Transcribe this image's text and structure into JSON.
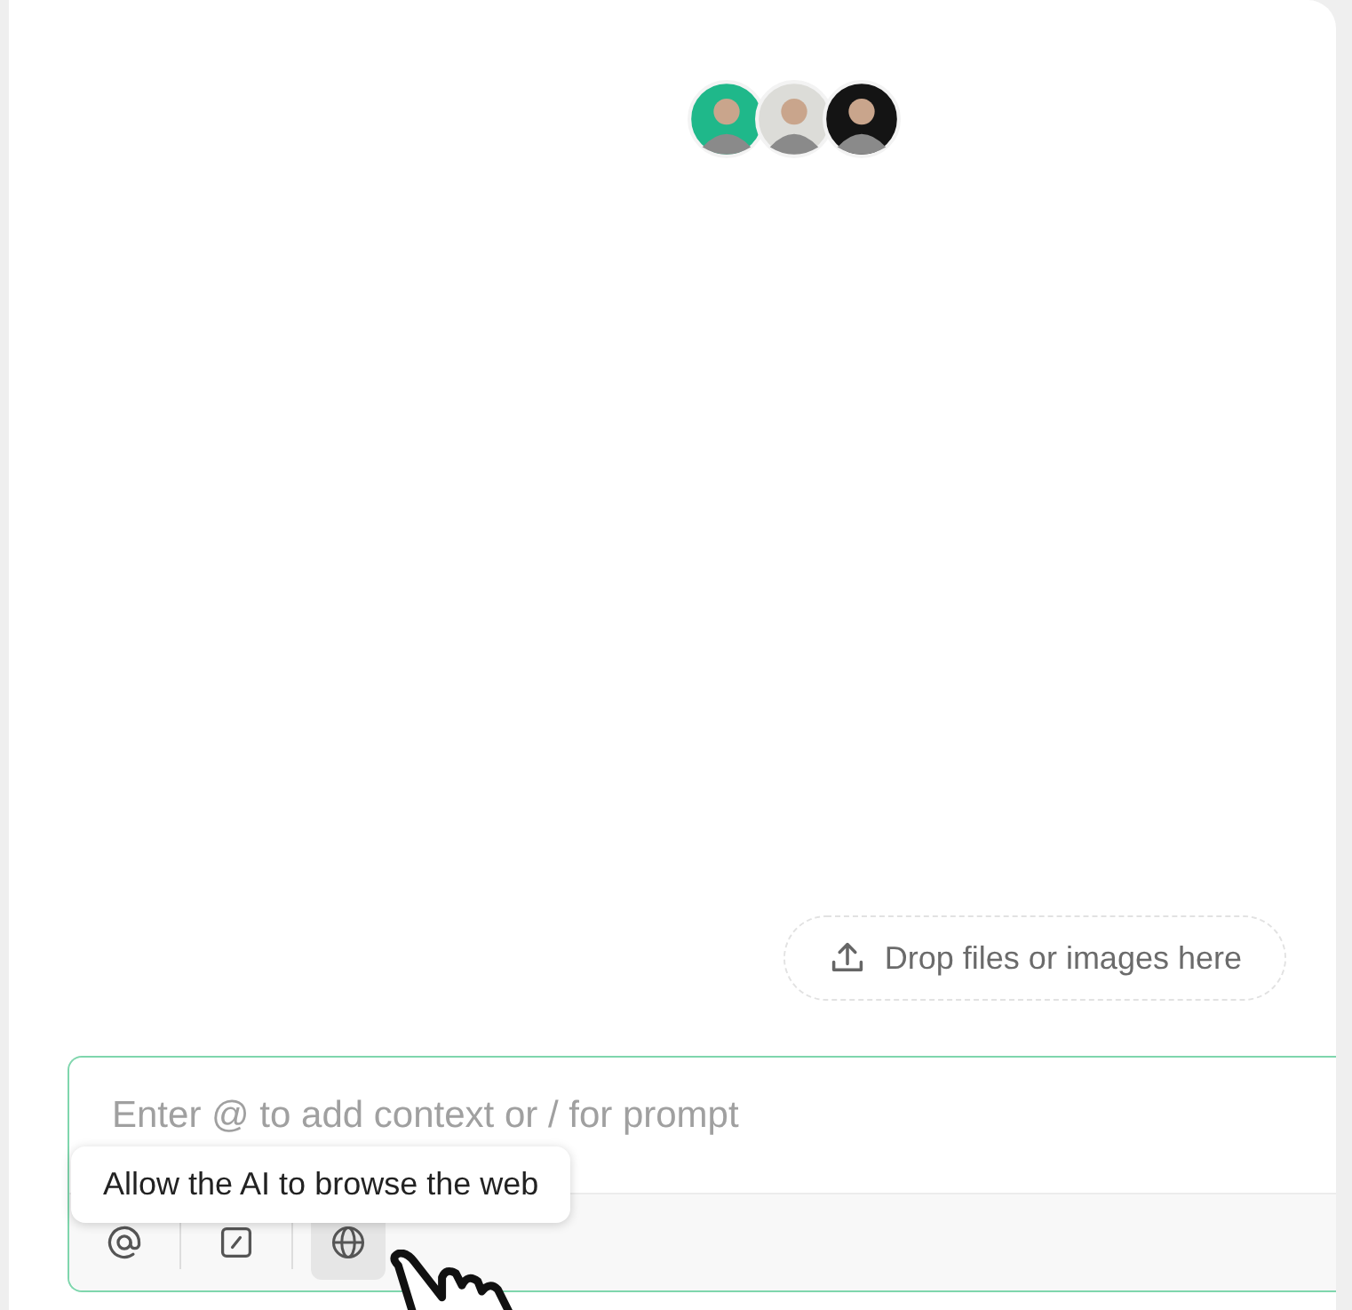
{
  "avatars": [
    {
      "color": "#1fb88a"
    },
    {
      "color": "#dcdcd8"
    },
    {
      "color": "#141414"
    }
  ],
  "drop_zone": {
    "label": "Drop files or images here"
  },
  "composer": {
    "placeholder": "Enter @ to add context or / for prompt",
    "tools": [
      {
        "kind": "mention",
        "hovered": false
      },
      {
        "kind": "prompt",
        "hovered": false
      },
      {
        "kind": "web",
        "hovered": true
      }
    ],
    "tooltip": "Allow the AI to browse the web"
  }
}
